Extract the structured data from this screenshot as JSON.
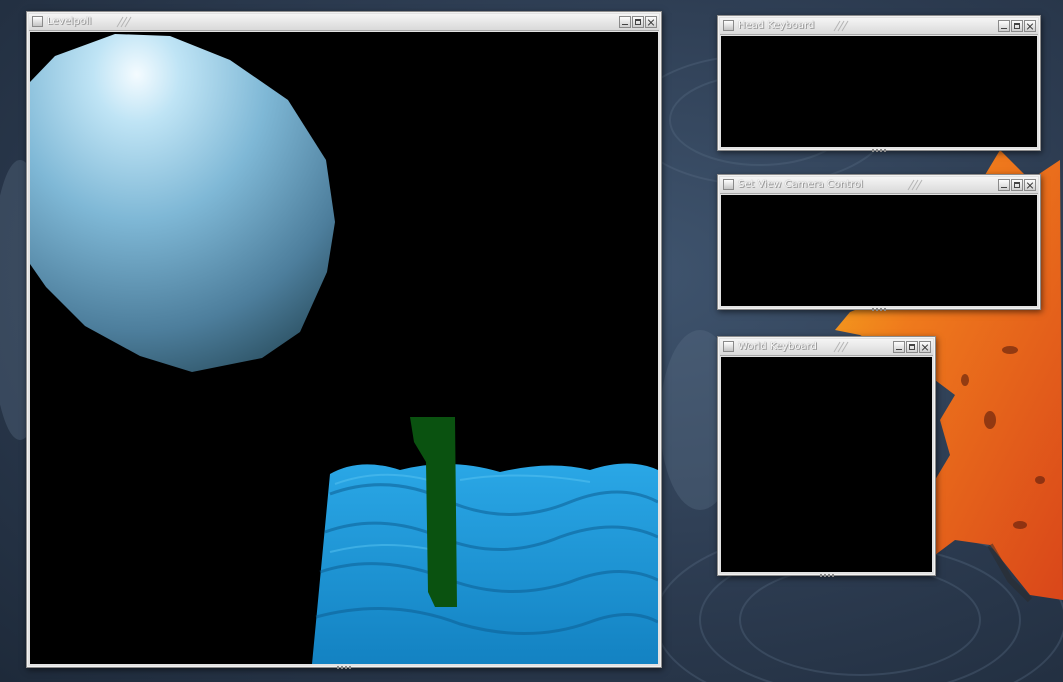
{
  "desktop": {
    "wallpaper": "autumn-leaf-on-water",
    "colors": {
      "background": "#2c3b50",
      "leaf": "#e8541a",
      "leaf_highlight": "#f7a21c"
    }
  },
  "windows": {
    "main": {
      "title": "Levelpoll",
      "scene": {
        "background": "#000000",
        "sphere_color": "#8fc6e2",
        "water_color": "#1f96d6",
        "post_color": "#0a5210"
      }
    },
    "head": {
      "title": "Head Keyboard"
    },
    "view": {
      "title": "Set View Camera Control"
    },
    "world": {
      "title": "World Keyboard"
    }
  },
  "icons": {
    "window_menu": "window-menu-icon",
    "minimize": "minimize-icon",
    "maximize": "maximize-icon",
    "close": "close-icon"
  }
}
